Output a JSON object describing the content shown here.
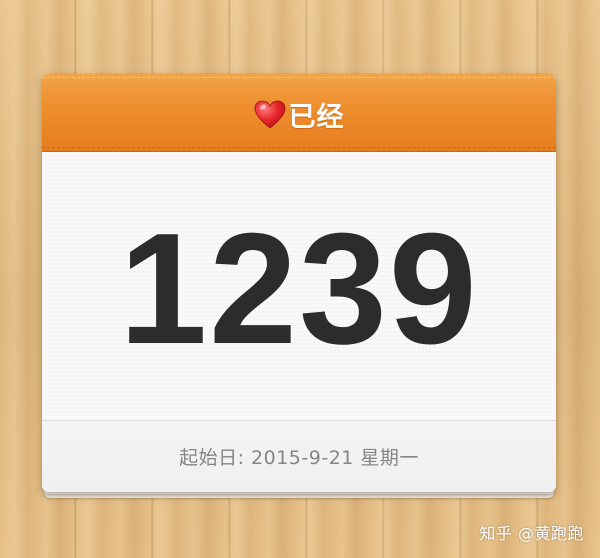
{
  "header": {
    "icon": "heart-icon",
    "title": "已经",
    "accent_color": "#ee8f2e"
  },
  "counter": {
    "days": "1239"
  },
  "footer": {
    "start_date": "起始日: 2015-9-21  星期一"
  },
  "watermark": {
    "text": "知乎 @黄跑跑"
  }
}
